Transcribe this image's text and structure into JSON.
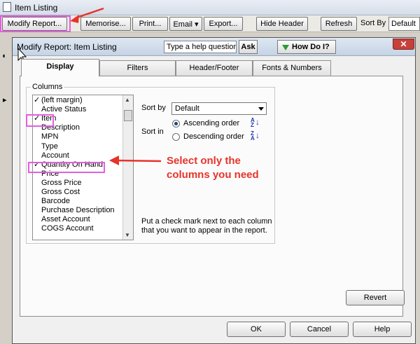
{
  "parent": {
    "title": "Item Listing",
    "toolbar": {
      "modify_report": "Modify Report...",
      "memorise": "Memorise...",
      "print": "Print...",
      "email": "Email ▾",
      "export": "Export...",
      "hide_header": "Hide Header",
      "refresh": "Refresh",
      "sort_by_label": "Sort By",
      "sort_by_value": "Default"
    }
  },
  "dialog": {
    "title": "Modify Report: Item Listing",
    "help_placeholder": "Type a help question",
    "ask_label": "Ask",
    "how_do_i_label": "How Do I?",
    "close_label": "✕",
    "tabs": [
      "Display",
      "Filters",
      "Header/Footer",
      "Fonts & Numbers"
    ],
    "columns_group_label": "Columns",
    "columns": [
      {
        "label": "(left margin)",
        "checked": true
      },
      {
        "label": "Active Status",
        "checked": false
      },
      {
        "label": "Item",
        "checked": true
      },
      {
        "label": "Description",
        "checked": false
      },
      {
        "label": "MPN",
        "checked": false
      },
      {
        "label": "Type",
        "checked": false
      },
      {
        "label": "Account",
        "checked": false
      },
      {
        "label": "Quantity On Hand",
        "checked": true
      },
      {
        "label": "Price",
        "checked": false
      },
      {
        "label": "Gross Price",
        "checked": false
      },
      {
        "label": "Gross Cost",
        "checked": false
      },
      {
        "label": "Barcode",
        "checked": false
      },
      {
        "label": "Purchase Description",
        "checked": false
      },
      {
        "label": "Asset Account",
        "checked": false
      },
      {
        "label": "COGS Account",
        "checked": false
      }
    ],
    "check_mark": "✓",
    "sort_by_label": "Sort by",
    "sort_by_value": "Default",
    "sort_in_label": "Sort in",
    "ascending_label": "Ascending order",
    "descending_label": "Descending order",
    "ascending_icon": "A\nZ",
    "descending_icon": "Z\nA",
    "hint": "Put a check mark next to each column that you want to appear in the report.",
    "revert_label": "Revert",
    "ok_label": "OK",
    "cancel_label": "Cancel",
    "help_label": "Help"
  },
  "annotation": {
    "text": "Select only the columns you need",
    "color": "#e8332a",
    "highlight_color": "#e55ee0"
  }
}
